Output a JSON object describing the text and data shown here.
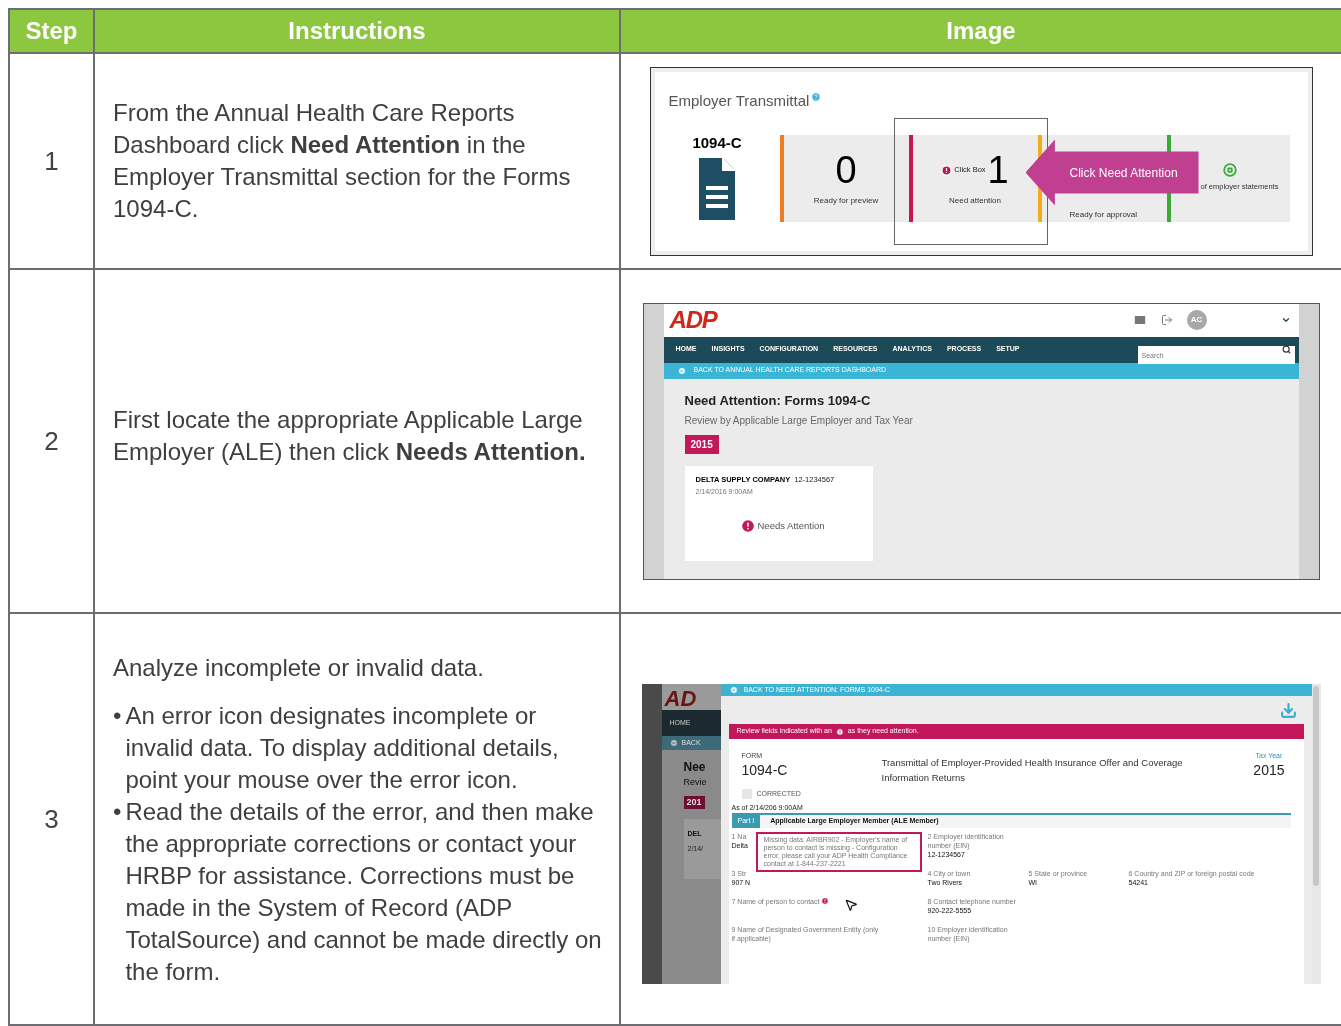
{
  "table": {
    "columns": [
      "Step",
      "Instructions",
      "Image"
    ],
    "rows": [
      {
        "step": "1",
        "instructions": {
          "paragraph": "From the Annual Health Care Reports Dashboard click **Need Attention** in the Employer Transmittal section for the Forms 1094-C."
        },
        "image": {
          "kind": "transmittal",
          "title": "Employer Transmittal",
          "form": "1094-C",
          "tiles": [
            {
              "count": "0",
              "label": "Ready for preview",
              "color": "#f07c22"
            },
            {
              "count": "1",
              "overlay": "Click Box",
              "label": "Need attention",
              "color": "#c8174e"
            },
            {
              "label": "Ready for approval",
              "color": "#f2ae1a"
            },
            {
              "label": "of employer statements",
              "color": "#3aaa35"
            }
          ],
          "callout": "Click Need Attention"
        }
      },
      {
        "step": "2",
        "instructions": {
          "paragraph": "First locate the appropriate Applicable Large Employer (ALE) then click **Needs Attention.**"
        },
        "image": {
          "kind": "dashboard",
          "logo": "ADP",
          "avatar": "AC",
          "nav": [
            "HOME",
            "INSIGHTS",
            "CONFIGURATION",
            "RESOURCES",
            "ANALYTICS",
            "PROCESS",
            "SETUP"
          ],
          "search": {
            "placeholder": "Search"
          },
          "back_link": "BACK TO ANNUAL HEALTH CARE REPORTS DASHBOARD",
          "heading": "Need Attention: Forms 1094-C",
          "subheading": "Review by Applicable Large Employer and Tax Year",
          "year": "2015",
          "card": {
            "company": "DELTA SUPPLY COMPANY",
            "ein": "12-1234567",
            "date": "2/14/2016 9:00AM",
            "status": "Needs Attention"
          }
        }
      },
      {
        "step": "3",
        "instructions": {
          "paragraph": "Analyze incomplete or invalid data.",
          "bullets": [
            {
              "marker": "•",
              "text": "An error icon designates incomplete or invalid data. To display additional details, point your mouse over the error icon."
            },
            {
              "marker": "•",
              "text": "Read the details of the error, and then make the appropriate corrections or contact your HRBP for assistance. Corrections must be made in the System of Record (ADP TotalSource) and cannot be made directly on the form."
            }
          ]
        },
        "image": {
          "kind": "form",
          "background": {
            "logo": "AD",
            "nav": "HOME",
            "back": "BACK",
            "heading": "Nee",
            "subheading": "Revie",
            "year": "201",
            "company": "DEL",
            "date": "2/14/"
          },
          "back_link": "BACK TO NEED ATTENTION: FORMS 1094-C",
          "alert_before": "Review fields indicated with an",
          "alert_after": "as they need attention.",
          "form_caption": "FORM",
          "form": "1094-C",
          "title": "Transmittal of Employer-Provided Health Insurance Offer and Coverage Information Returns",
          "tax_year_label": "Tax Year",
          "tax_year": "2015",
          "corrected": {
            "label": "CORRECTED",
            "checked": false
          },
          "as_of": "As of 2/14/206 9:00AM",
          "part": "Part I",
          "part_title": "Applicable Large Employer Member (ALE Member)",
          "fields": [
            [
              {
                "label": "1 Na",
                "value": "Delta"
              },
              {
                "label": "2 Employer identification number (EIN)",
                "value": "12-1234567"
              }
            ],
            [
              {
                "label": "3 Str",
                "value": "907 N"
              },
              {
                "label": "4 City or town",
                "value": "Two Rivers"
              },
              {
                "label": "5 State or province",
                "value": "WI"
              },
              {
                "label": "6 Country and ZIP or foreign postal code",
                "value": "54241"
              }
            ],
            [
              {
                "label": "7 Name of person to contact",
                "error": true
              },
              {
                "label": "8 Contact telephone number",
                "value": "920-222-5555"
              }
            ],
            [
              {
                "label": "9 Name of Designated Government Entity (only if applicable)"
              },
              {
                "label": "10 Employer identification number (EIN)"
              }
            ]
          ],
          "tooltip": "Missing data: AIRBR902 - Employer's name of person to contact is missing - Configuration error, please call your ADP Health Compliance contact at 1-844-237-2221"
        }
      }
    ]
  }
}
